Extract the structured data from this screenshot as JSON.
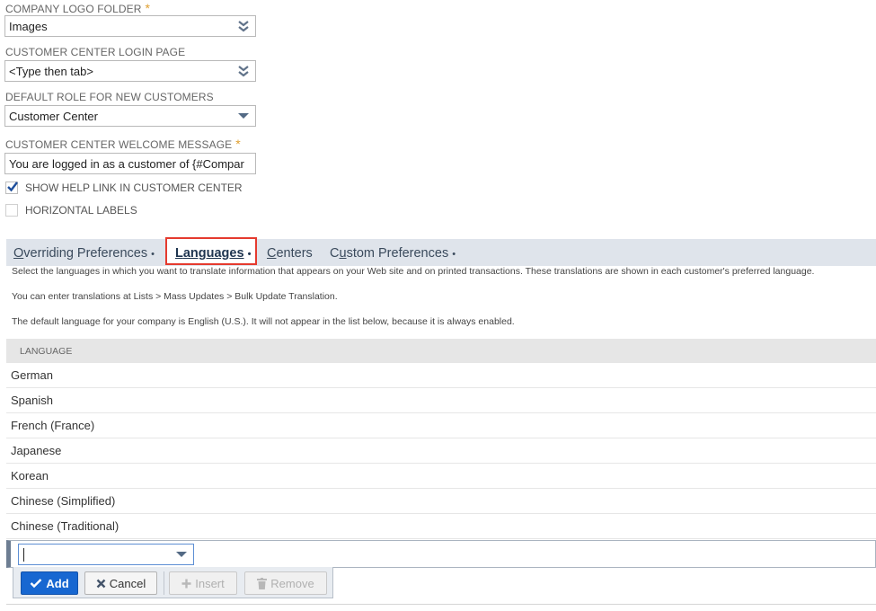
{
  "fields": {
    "logo_folder": {
      "label": "COMPANY LOGO FOLDER",
      "required": "*",
      "value": "Images"
    },
    "login_page": {
      "label": "CUSTOMER CENTER LOGIN PAGE",
      "value": "<Type then tab>"
    },
    "default_role": {
      "label": "DEFAULT ROLE FOR NEW CUSTOMERS",
      "value": "Customer Center"
    },
    "welcome_message": {
      "label": "CUSTOMER CENTER WELCOME MESSAGE",
      "required": "*",
      "value": "You are logged in as a customer of {#Compar"
    }
  },
  "checkboxes": {
    "show_help": {
      "label": "SHOW HELP LINK IN CUSTOMER CENTER",
      "checked": true
    },
    "horizontal_labels": {
      "label": "HORIZONTAL LABELS",
      "checked": false
    }
  },
  "tabs": [
    {
      "label_first": "O",
      "label_rest": "verriding Preferences",
      "dot": "•"
    },
    {
      "label_first": "L",
      "label_rest": "anguages",
      "dot": "•",
      "active": true
    },
    {
      "label_first": "C",
      "label_rest": "enters",
      "dot": ""
    },
    {
      "label_first": "Cu",
      "label_first_plain": "C",
      "label_under": "u",
      "label_rest": "stom Preferences",
      "dot": "•"
    }
  ],
  "info": {
    "line1": "Select the languages in which you want to translate information that appears on your Web site and on printed transactions. These translations are shown in each customer's preferred language.",
    "line2": "You can enter translations at Lists > Mass Updates > Bulk Update Translation.",
    "line3": "The default language for your company is English (U.S.). It will not appear in the list below, because it is always enabled."
  },
  "languages": {
    "header": "LANGUAGE",
    "rows": [
      "German",
      "Spanish",
      "French (France)",
      "Japanese",
      "Korean",
      "Chinese (Simplified)",
      "Chinese (Traditional)"
    ]
  },
  "buttons": {
    "add": "Add",
    "cancel": "Cancel",
    "insert": "Insert",
    "remove": "Remove"
  },
  "colors": {
    "accent": "#1767d1",
    "highlight": "#e53a2e",
    "required": "#e0a030",
    "check": "#1e4f9c"
  }
}
